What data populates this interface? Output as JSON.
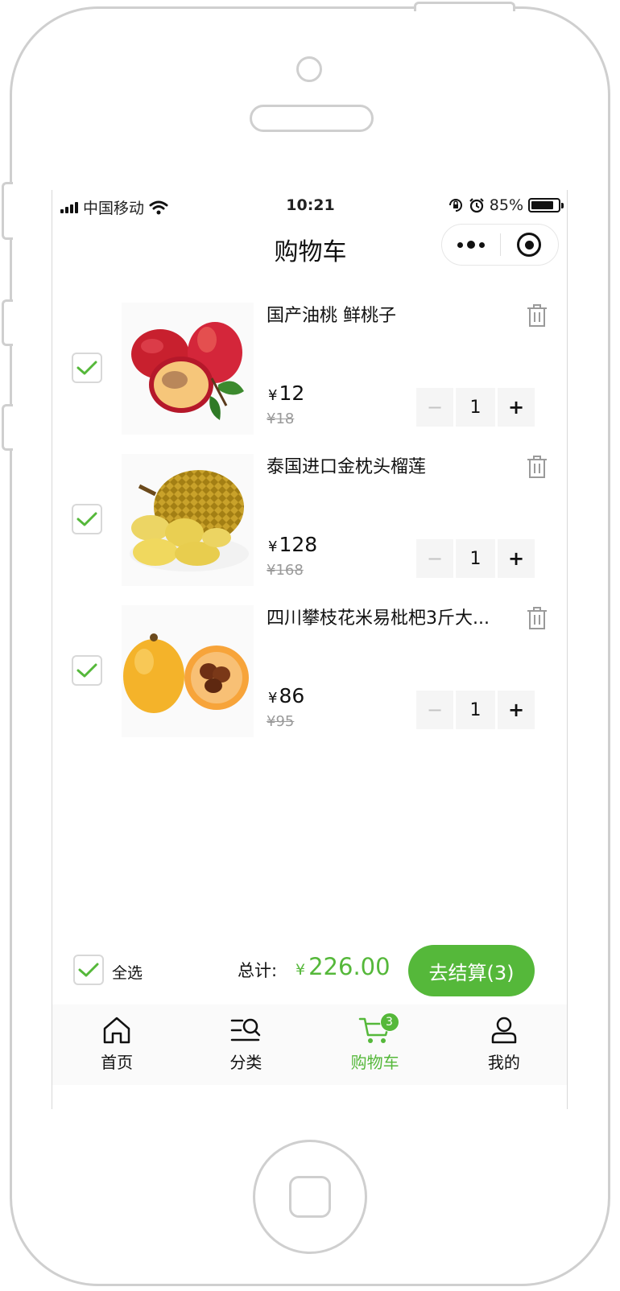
{
  "status_bar": {
    "carrier": "中国移动",
    "time": "10:21",
    "battery": "85%",
    "battery_level": 0.85
  },
  "nav": {
    "title": "购物车"
  },
  "cart": {
    "currency_symbol": "¥",
    "items": [
      {
        "name": "国产油桃 鲜桃子",
        "price": "12",
        "original_price": "¥18",
        "quantity": "1",
        "decrease": "−",
        "increase": "+",
        "checked": true,
        "image": "nectarine"
      },
      {
        "name": "泰国进口金枕头榴莲",
        "price": "128",
        "original_price": "¥168",
        "quantity": "1",
        "decrease": "−",
        "increase": "+",
        "checked": true,
        "image": "durian"
      },
      {
        "name": "四川攀枝花米易枇杷3斤大...",
        "price": "86",
        "original_price": "¥95",
        "quantity": "1",
        "decrease": "−",
        "increase": "+",
        "checked": true,
        "image": "loquat"
      }
    ]
  },
  "footer": {
    "select_all_label": "全选",
    "total_label": "总计:",
    "total_value": "226.00",
    "checkout_label": "去结算(3)"
  },
  "tabs": [
    {
      "label": "首页",
      "icon": "home-icon"
    },
    {
      "label": "分类",
      "icon": "category-search-icon"
    },
    {
      "label": "购物车",
      "icon": "cart-icon",
      "badge": "3",
      "active": true
    },
    {
      "label": "我的",
      "icon": "user-icon"
    }
  ],
  "colors": {
    "accent": "#55b83a",
    "text": "#111111",
    "muted": "#9a9a9a",
    "stepper_bg": "#f5f5f5"
  }
}
